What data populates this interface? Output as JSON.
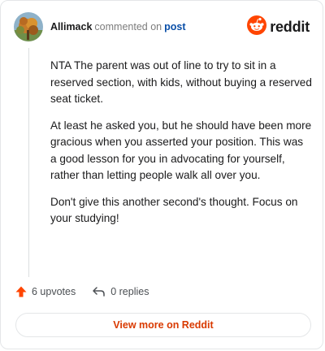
{
  "header": {
    "username": "Allimack",
    "action_text": "commented on",
    "post_link": "post",
    "brand_name": "reddit"
  },
  "comment": {
    "paragraphs": [
      "NTA The parent was out of line to try to sit in a reserved section, with kids, without buying a reserved seat ticket.",
      "At least he asked you, but he should have been more gracious when you asserted your position. This was a good lesson for you in advocating for yourself, rather than letting people walk all over you.",
      "Don't give this another second's thought. Focus on your studying!"
    ]
  },
  "footer": {
    "upvotes": "6 upvotes",
    "replies": "0 replies",
    "view_more": "View more on Reddit"
  },
  "colors": {
    "brand_orange": "#ff4500",
    "link_blue": "#0a4fa8",
    "view_more_text": "#d93a00"
  },
  "icons": {
    "upvote": "upvote-arrow-icon",
    "reply": "reply-arrow-icon",
    "brand": "reddit-snoo-logo"
  }
}
